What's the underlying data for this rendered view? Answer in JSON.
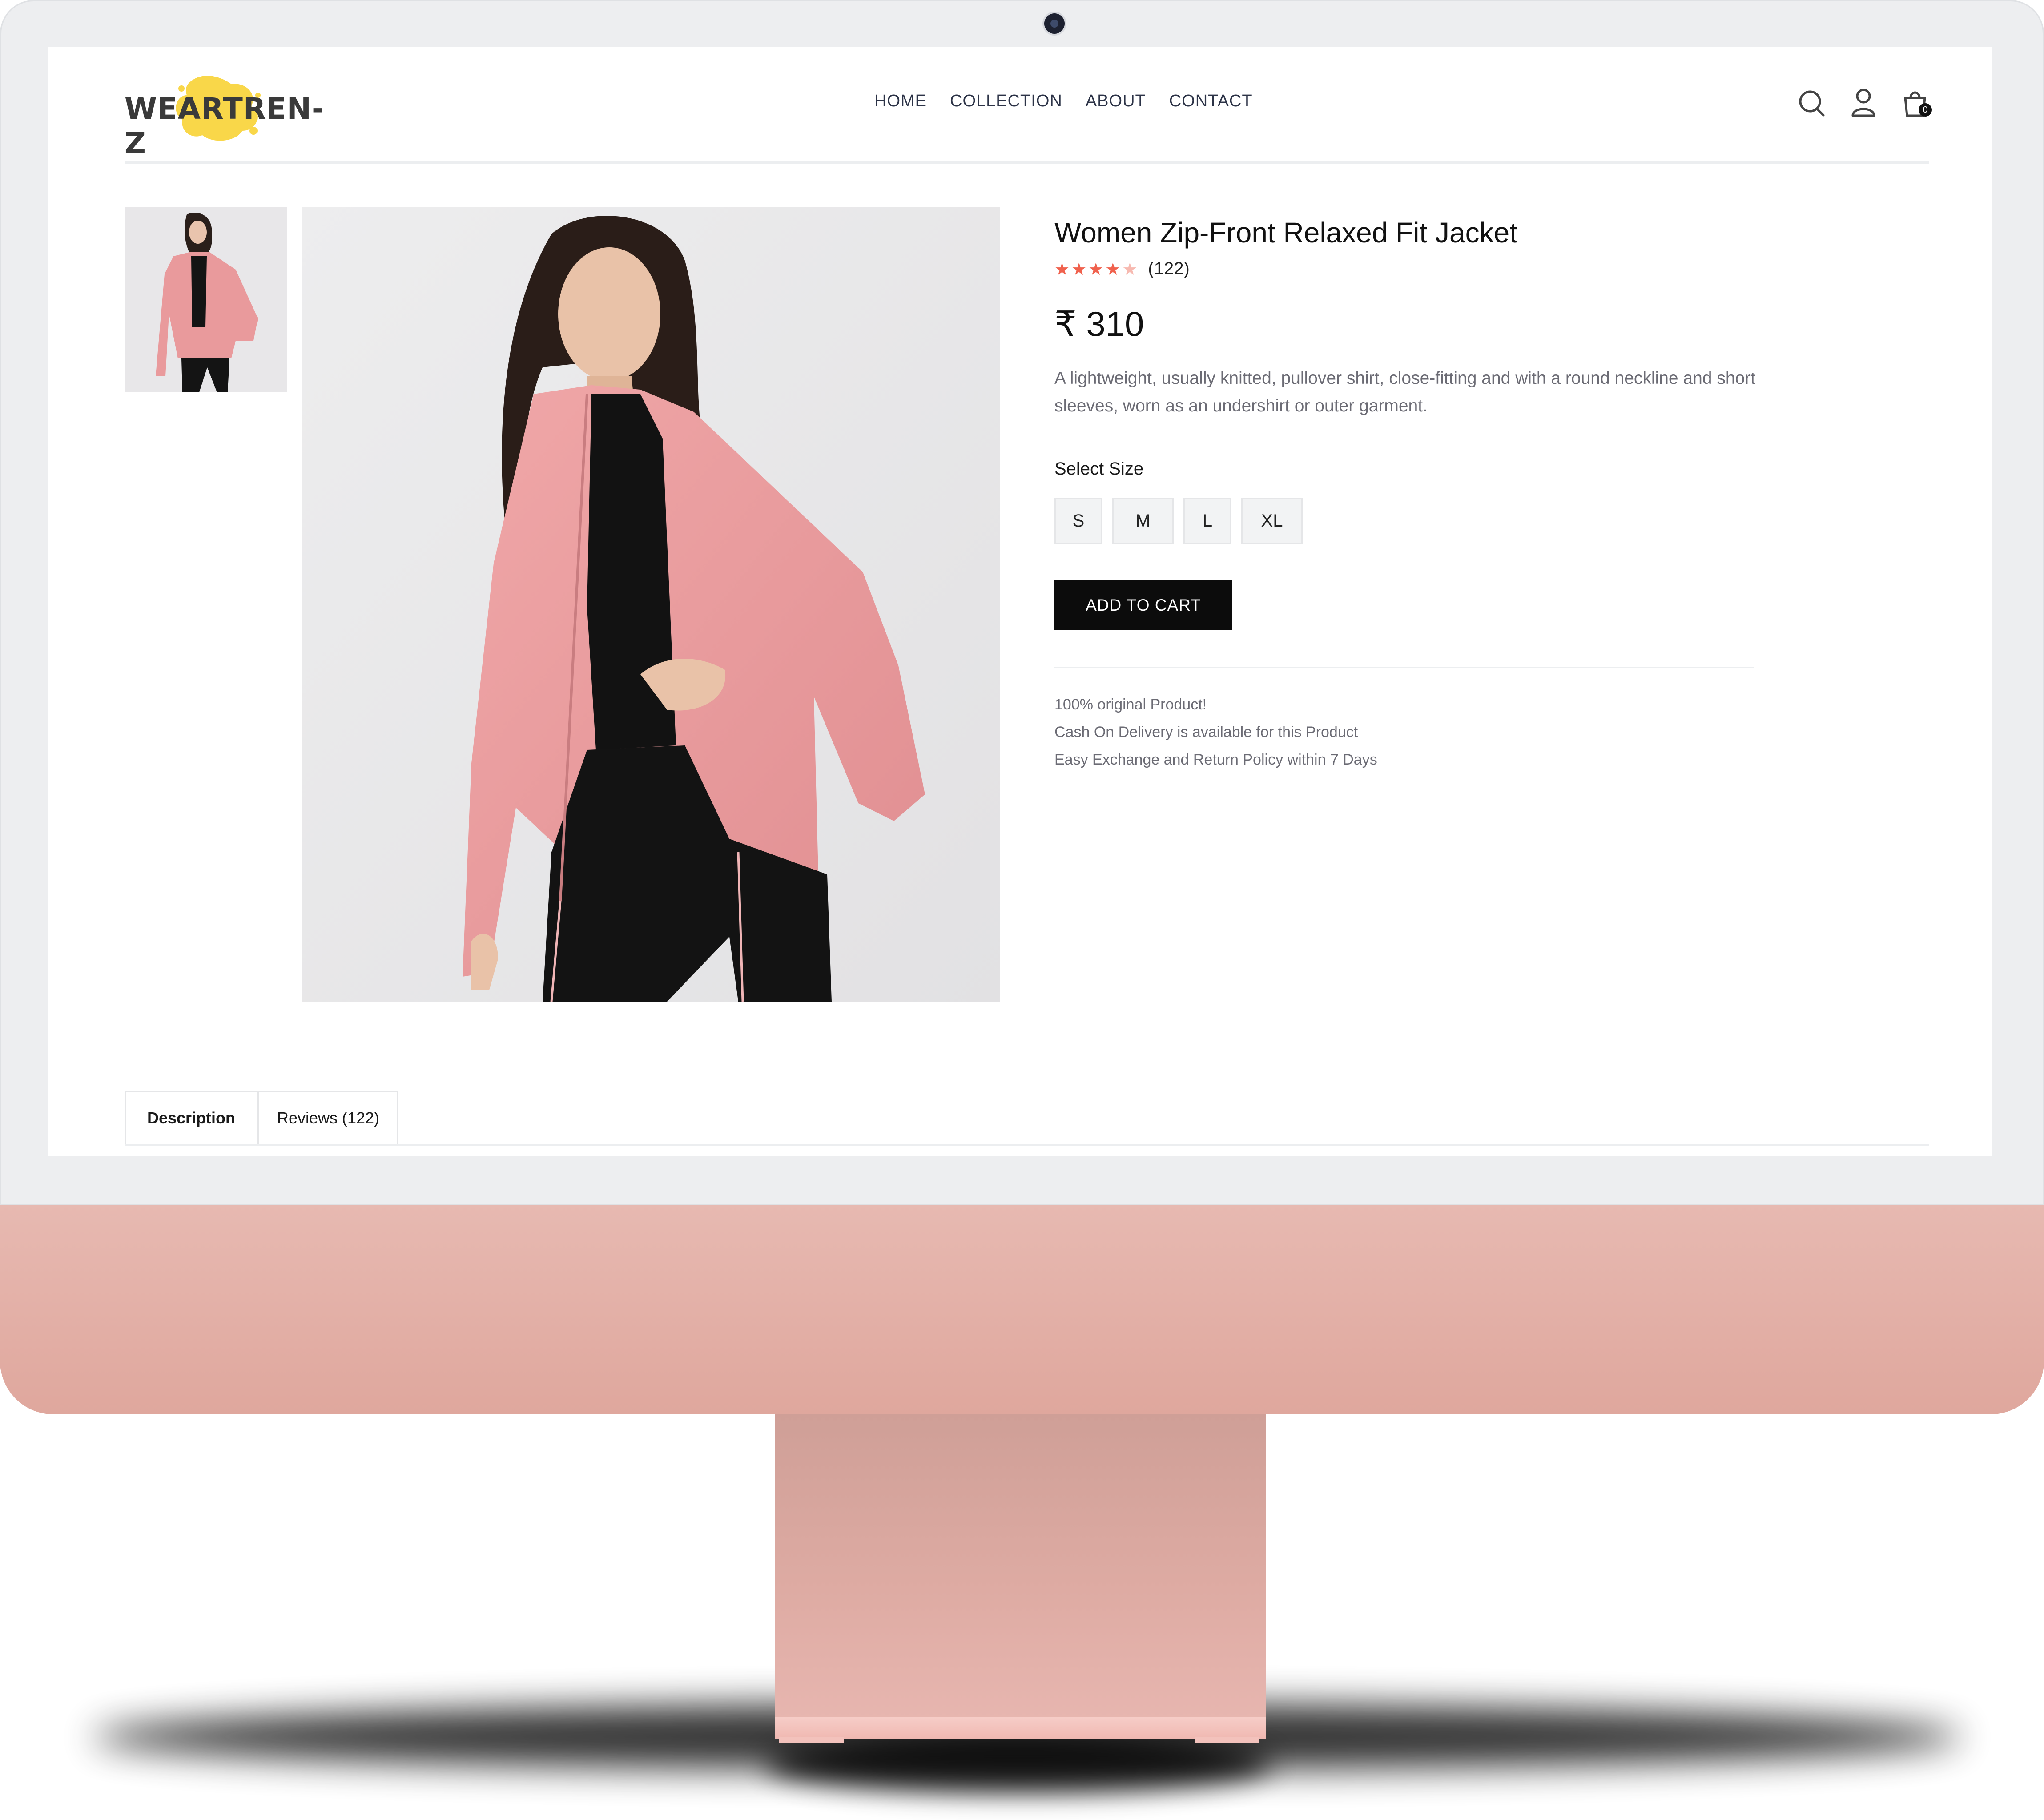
{
  "brand": {
    "logo_text": "WEARTREN-Z",
    "logo_color": "#f9d749"
  },
  "nav": {
    "items": [
      "HOME",
      "COLLECTION",
      "ABOUT",
      "CONTACT"
    ]
  },
  "header_icons": {
    "search": "search-icon",
    "account": "user-icon",
    "cart": "shopping-bag-icon",
    "cart_count": "0"
  },
  "product": {
    "title": "Women Zip-Front Relaxed Fit Jacket",
    "rating": 4,
    "rating_max": 5,
    "review_count": "(122)",
    "price": "₹ 310",
    "description": "A lightweight, usually knitted, pullover shirt, close-fitting and with a round neckline and short sleeves, worn as an undershirt or outer garment.",
    "size_label": "Select Size",
    "sizes": [
      "S",
      "M",
      "L",
      "XL"
    ],
    "add_to_cart": "ADD TO CART",
    "features": [
      "100% original Product!",
      "Cash On Delivery is available for this Product",
      "Easy Exchange and Return Policy within 7 Days"
    ]
  },
  "tabs": {
    "description": "Description",
    "reviews": "Reviews (122)"
  },
  "colors": {
    "star": "#f0614d",
    "button": "#0c0c0c",
    "chin": "#e2ada4",
    "jacket": "#e99a9c"
  }
}
